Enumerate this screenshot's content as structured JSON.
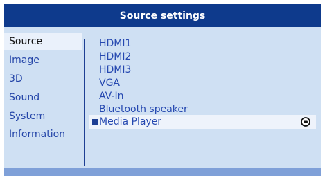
{
  "header": {
    "title": "Source settings"
  },
  "sidebar": {
    "items": [
      {
        "label": "Source"
      },
      {
        "label": "Image"
      },
      {
        "label": "3D"
      },
      {
        "label": "Sound"
      },
      {
        "label": "System"
      },
      {
        "label": "Information"
      }
    ],
    "selected": "Source"
  },
  "sources": {
    "items": [
      {
        "label": "HDMI1"
      },
      {
        "label": "HDMI2"
      },
      {
        "label": "HDMI3"
      },
      {
        "label": "VGA"
      },
      {
        "label": "AV-In"
      },
      {
        "label": "Bluetooth speaker"
      },
      {
        "label": "Media Player"
      }
    ],
    "selected": "Media Player",
    "confirm_icon": "ok-button-icon"
  },
  "colors": {
    "header_bg": "#0e3a8c",
    "panel_bg": "#cfe0f3",
    "accent_text": "#2548b0",
    "footer": "#7fa0d8"
  }
}
